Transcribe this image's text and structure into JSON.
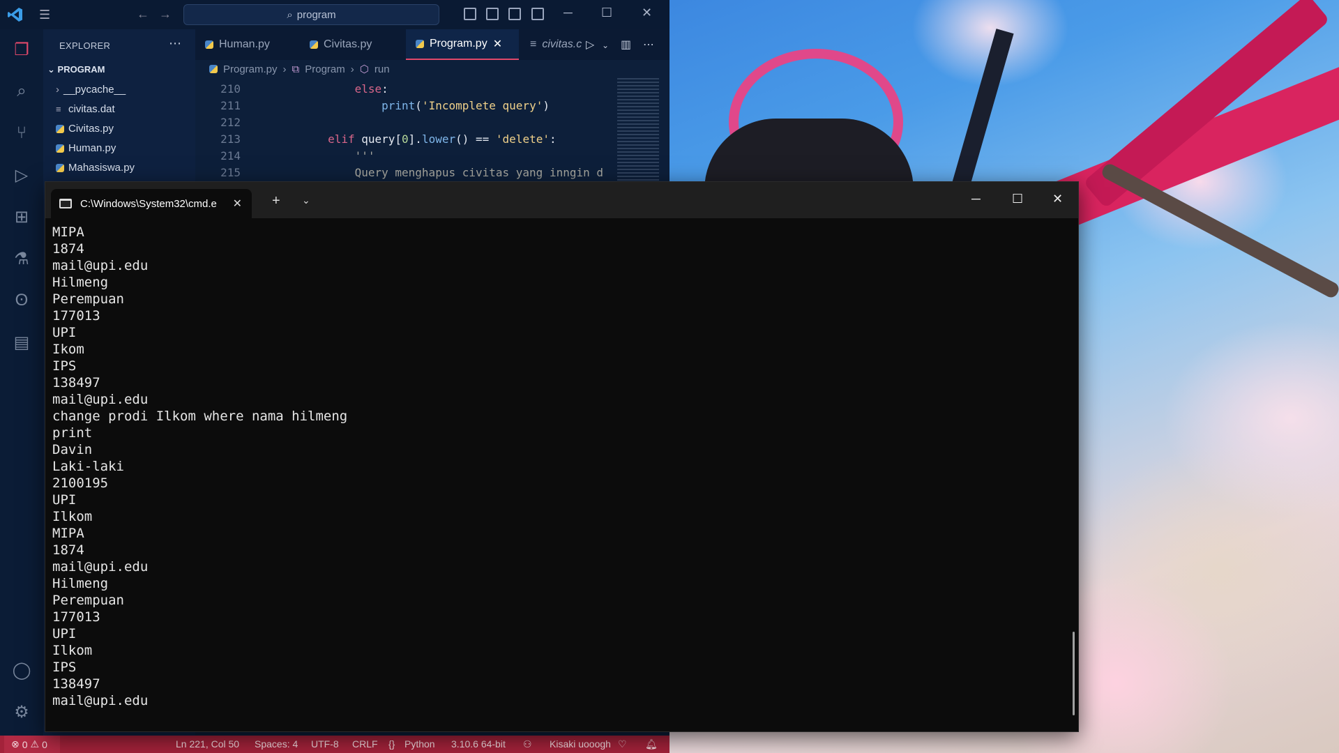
{
  "vscode": {
    "search_text": "program",
    "sidebar": {
      "header": "EXPLORER",
      "section": "PROGRAM",
      "items": [
        {
          "label": "__pycache__",
          "type": "folder"
        },
        {
          "label": "civitas.dat",
          "type": "text"
        },
        {
          "label": "Civitas.py",
          "type": "python"
        },
        {
          "label": "Human.py",
          "type": "python"
        },
        {
          "label": "Mahasiswa.py",
          "type": "python"
        }
      ]
    },
    "tabs": [
      {
        "label": "Human.py",
        "active": false
      },
      {
        "label": "Civitas.py",
        "active": false
      },
      {
        "label": "Program.py",
        "active": true
      },
      {
        "label": "civitas.c",
        "active": false
      }
    ],
    "breadcrumb": [
      "Program.py",
      "Program",
      "run"
    ],
    "code": [
      {
        "ln": "210",
        "parts": [
          {
            "t": "            "
          },
          {
            "t": "else",
            "c": "kw"
          },
          {
            "t": ":",
            "c": "var"
          }
        ]
      },
      {
        "ln": "211",
        "parts": [
          {
            "t": "                "
          },
          {
            "t": "print",
            "c": "fn"
          },
          {
            "t": "(",
            "c": "var"
          },
          {
            "t": "'Incomplete query'",
            "c": "str"
          },
          {
            "t": ")",
            "c": "var"
          }
        ]
      },
      {
        "ln": "212",
        "parts": []
      },
      {
        "ln": "213",
        "parts": [
          {
            "t": "        "
          },
          {
            "t": "elif",
            "c": "kw"
          },
          {
            "t": " query[",
            "c": "var"
          },
          {
            "t": "0",
            "c": "num"
          },
          {
            "t": "].",
            "c": "var"
          },
          {
            "t": "lower",
            "c": "fn"
          },
          {
            "t": "() == ",
            "c": "var"
          },
          {
            "t": "'delete'",
            "c": "str"
          },
          {
            "t": ":",
            "c": "var"
          }
        ]
      },
      {
        "ln": "214",
        "parts": [
          {
            "t": "            "
          },
          {
            "t": "'''",
            "c": "cmt"
          }
        ]
      },
      {
        "ln": "215",
        "parts": [
          {
            "t": "            "
          },
          {
            "t": "Query menghapus civitas yang inngin d",
            "c": "cmt"
          }
        ]
      }
    ],
    "status": {
      "errors": "0",
      "warnings": "0",
      "position": "Ln 221, Col 50",
      "spaces": "Spaces: 4",
      "encoding": "UTF-8",
      "eol": "CRLF",
      "language": "Python",
      "interpreter": "3.10.6 64-bit",
      "user": "Kisaki uooogh"
    },
    "colors": {
      "status_bar": "#a3223a",
      "accent": "#e0486a"
    }
  },
  "terminal": {
    "tab_title": "C:\\Windows\\System32\\cmd.e",
    "lines": [
      "MIPA",
      "1874",
      "mail@upi.edu",
      "Hilmeng",
      "Perempuan",
      "177013",
      "UPI",
      "Ikom",
      "IPS",
      "138497",
      "mail@upi.edu",
      "change prodi Ilkom where nama hilmeng",
      "print",
      "Davin",
      "Laki-laki",
      "2100195",
      "UPI",
      "Ilkom",
      "MIPA",
      "1874",
      "mail@upi.edu",
      "Hilmeng",
      "Perempuan",
      "177013",
      "UPI",
      "Ilkom",
      "IPS",
      "138497",
      "mail@upi.edu"
    ]
  }
}
